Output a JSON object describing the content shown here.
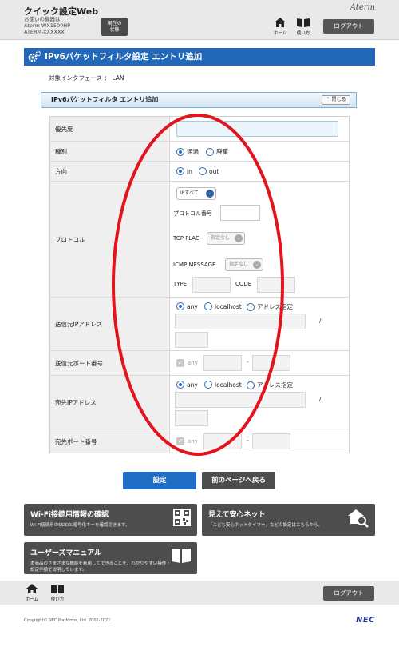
{
  "header": {
    "title": "クイック設定Web",
    "device_line1": "お使いの機器は",
    "device_line2": "Aterm WX1500HP",
    "device_line3": "ATERM-XXXXXX",
    "status_line1": "現在の",
    "status_line2": "状態",
    "brand": "Aterm",
    "home_label": "ホーム",
    "help_label": "使い方",
    "logout_label": "ログアウト"
  },
  "page": {
    "title": "IPv6パケットフィルタ設定 エントリ追加",
    "interface_text": "対象インタフェース ： LAN",
    "section_title": "IPv6パケットフィルタ エントリ追加",
    "close_label": "閉じる"
  },
  "form": {
    "priority": {
      "label": "優先度",
      "value": ""
    },
    "type": {
      "label": "種別",
      "options": [
        "通過",
        "廃棄"
      ],
      "selected": "通過"
    },
    "direction": {
      "label": "方向",
      "options": [
        "in",
        "out"
      ],
      "selected": "in"
    },
    "protocol": {
      "label": "プロトコル",
      "select_value": "IPすべて",
      "number_label": "プロトコル番号",
      "tcp_flag_label": "TCP FLAG",
      "tcp_flag_value": "指定なし",
      "icmp_label": "ICMP MESSAGE",
      "icmp_value": "指定なし",
      "type_label": "TYPE",
      "code_label": "CODE"
    },
    "src_ip": {
      "label": "送信元IPアドレス",
      "options": [
        "any",
        "localhost",
        "アドレス指定"
      ],
      "selected": "any",
      "slash": "/"
    },
    "src_port": {
      "label": "送信元ポート番号",
      "any_label": "any",
      "dash": "-"
    },
    "dst_ip": {
      "label": "宛先IPアドレス",
      "options": [
        "any",
        "localhost",
        "アドレス指定"
      ],
      "selected": "any",
      "slash": "/"
    },
    "dst_port": {
      "label": "宛先ポート番号",
      "any_label": "any",
      "dash": "-"
    }
  },
  "actions": {
    "submit_label": "設定",
    "back_label": "前のページへ戻る"
  },
  "tiles": [
    {
      "title": "Wi-Fi接続用情報の確認",
      "desc": "Wi-Fi接続用のSSIDと暗号化キーを確認できます。"
    },
    {
      "title": "見えて安心ネット",
      "desc": "「こども安心ネットタイマー」などの設定はこちらから。"
    },
    {
      "title": "ユーザーズマニュアル",
      "desc": "本商品のさまざまな機能を利用してできることを、わかりやすい操作・設定手順で説明しています。"
    }
  ],
  "footer": {
    "home_label": "ホーム",
    "help_label": "使い方",
    "logout_label": "ログアウト",
    "copyright": "Copyright© NEC Platforms, Ltd. 2001-2022",
    "nec": "NEC"
  },
  "colors": {
    "accent_blue": "#2168b8",
    "button_blue": "#1f6dc4",
    "button_dark": "#4d4d4d",
    "annotation_red": "#e3141b"
  }
}
